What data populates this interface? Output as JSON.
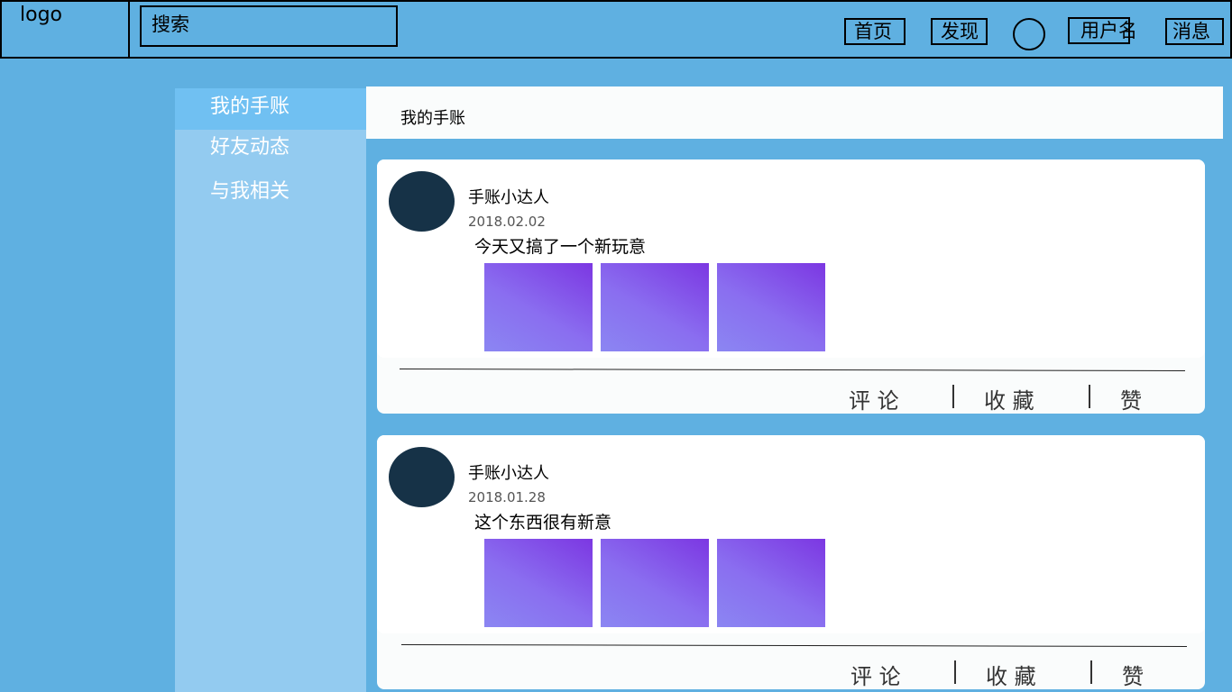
{
  "topbar": {
    "logo": "logo",
    "search_label": "搜索",
    "nav": {
      "home": "首页",
      "discover": "发现",
      "username": "用户名",
      "messages": "消息"
    }
  },
  "sidebar": {
    "items": [
      {
        "label": "我的手账"
      },
      {
        "label": "好友动态"
      },
      {
        "label": "与我相关"
      }
    ]
  },
  "main": {
    "header_title": "我的手账",
    "posts": [
      {
        "user": "手账小达人",
        "date": "2018.02.02",
        "text": "今天又搞了一个新玩意",
        "actions": {
          "comment": "评 论",
          "favorite": "收 藏",
          "like": "赞"
        }
      },
      {
        "user": "手账小达人",
        "date": "2018.01.28",
        "text": "这个东西很有新意",
        "actions": {
          "comment": "评 论",
          "favorite": "收 藏",
          "like": "赞"
        }
      }
    ]
  },
  "colors": {
    "background": "#5fb0e1",
    "sidebar": "#93cbf0",
    "sidebar_active": "#70c0f2",
    "avatar": "#163247",
    "thumbnail": "#8a6ef0"
  }
}
